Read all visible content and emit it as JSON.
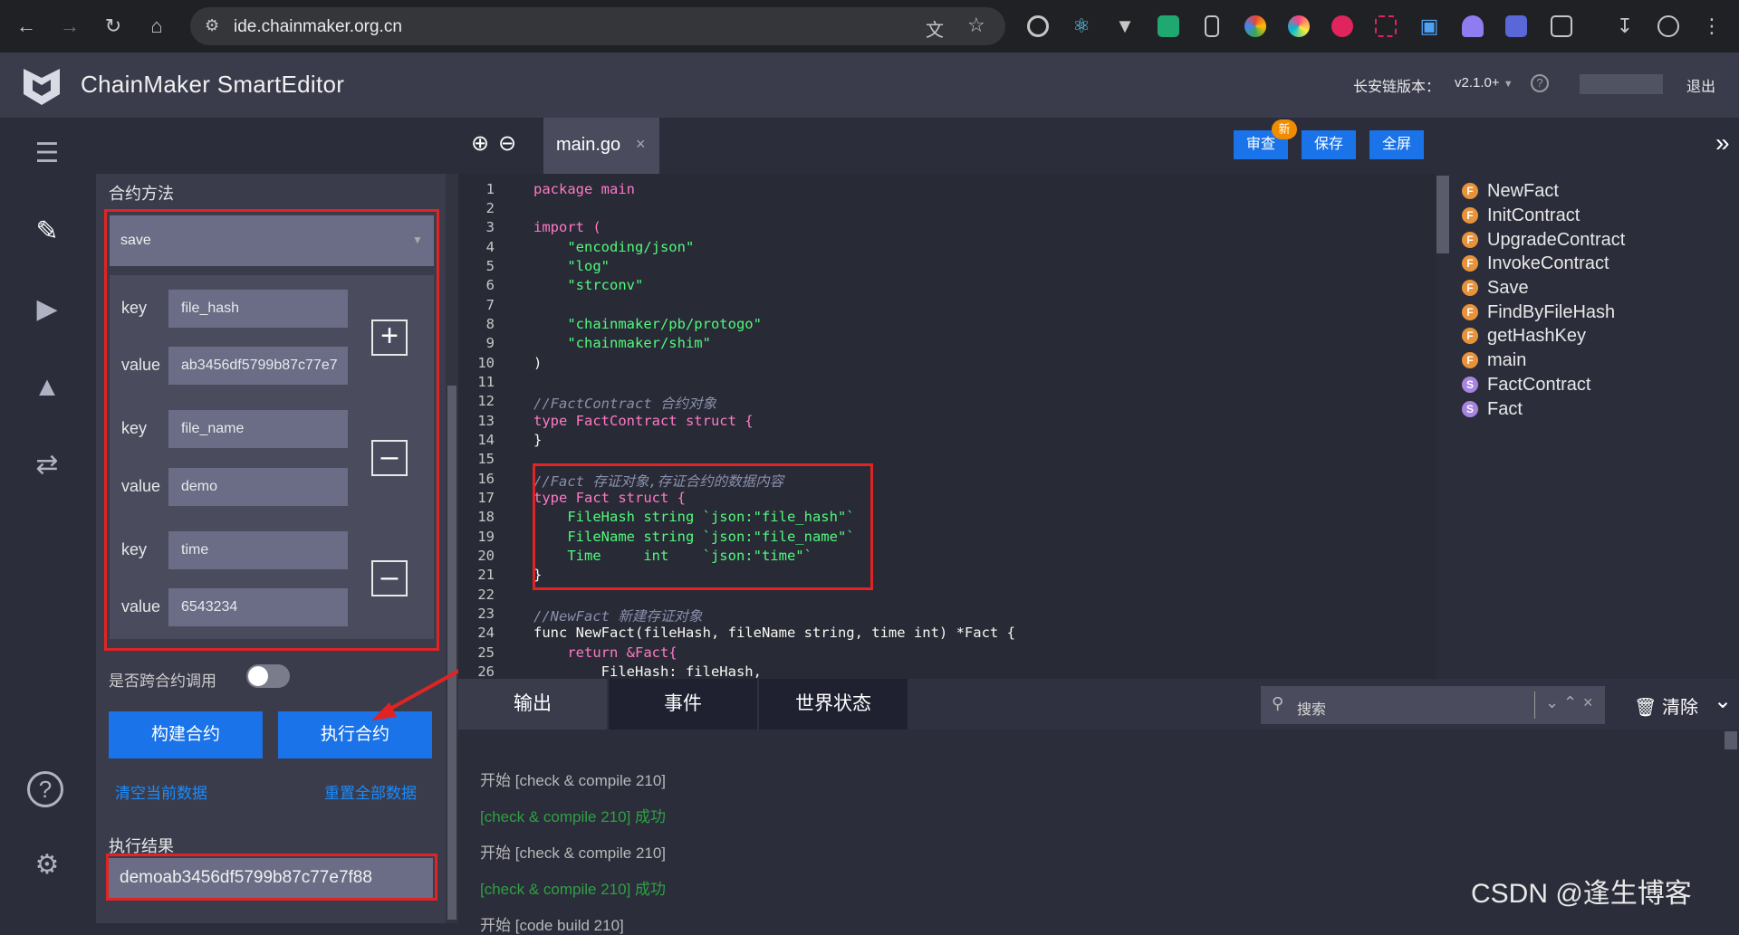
{
  "browser": {
    "url": "ide.chainmaker.org.cn"
  },
  "app": {
    "title": "ChainMaker SmartEditor",
    "version_label": "长安链版本：",
    "version_value": "v2.1.0+",
    "logout": "退出"
  },
  "panel": {
    "section_title": "合约方法",
    "method_selected": "save",
    "params": [
      {
        "key_label": "key",
        "key": "file_hash",
        "value_label": "value",
        "value": "ab3456df5799b87c77e7"
      },
      {
        "key_label": "key",
        "key": "file_name",
        "value_label": "value",
        "value": "demo"
      },
      {
        "key_label": "key",
        "key": "time",
        "value_label": "value",
        "value": "6543234"
      }
    ],
    "cross_contract_label": "是否跨合约调用",
    "build_button": "构建合约",
    "execute_button": "执行合约",
    "clear_current": "清空当前数据",
    "reset_all": "重置全部数据",
    "result_label": "执行结果",
    "result_value": "demoab3456df5799b87c77e7f88"
  },
  "editor": {
    "tab_name": "main.go",
    "review_button": "审查",
    "new_badge": "新",
    "save_button": "保存",
    "fullscreen_button": "全屏",
    "code_lines": [
      "package main",
      "",
      "import (",
      "    \"encoding/json\"",
      "    \"log\"",
      "    \"strconv\"",
      "",
      "    \"chainmaker/pb/protogo\"",
      "    \"chainmaker/shim\"",
      ")",
      "",
      "//FactContract 合约对象",
      "type FactContract struct {",
      "}",
      "",
      "//Fact 存证对象,存证合约的数据内容",
      "type Fact struct {",
      "    FileHash string `json:\"file_hash\"`",
      "    FileName string `json:\"file_name\"`",
      "    Time     int    `json:\"time\"`",
      "}",
      "",
      "//NewFact 新建存证对象",
      "func NewFact(fileHash, fileName string, time int) *Fact {",
      "    return &Fact{",
      "        FileHash: fileHash,"
    ],
    "line_numbers": [
      "1",
      "2",
      "3",
      "4",
      "5",
      "6",
      "7",
      "8",
      "9",
      "10",
      "11",
      "12",
      "13",
      "14",
      "15",
      "16",
      "17",
      "18",
      "19",
      "20",
      "21",
      "22",
      "23",
      "24",
      "25",
      "26"
    ]
  },
  "outline": [
    {
      "badge": "F",
      "name": "NewFact"
    },
    {
      "badge": "F",
      "name": "InitContract"
    },
    {
      "badge": "F",
      "name": "UpgradeContract"
    },
    {
      "badge": "F",
      "name": "InvokeContract"
    },
    {
      "badge": "F",
      "name": "Save"
    },
    {
      "badge": "F",
      "name": "FindByFileHash"
    },
    {
      "badge": "F",
      "name": "getHashKey"
    },
    {
      "badge": "F",
      "name": "main"
    },
    {
      "badge": "S",
      "name": "FactContract"
    },
    {
      "badge": "S",
      "name": "Fact"
    }
  ],
  "bottom": {
    "tabs": [
      "输出",
      "事件",
      "世界状态"
    ],
    "search_placeholder": "搜索",
    "clear_button": "清除",
    "output_lines": [
      {
        "text": "开始 [check & compile 210]",
        "color": "#b8b8b8"
      },
      {
        "text": "[check & compile 210] 成功",
        "color": "#2ea043"
      },
      {
        "text": "开始 [check & compile 210]",
        "color": "#b8b8b8"
      },
      {
        "text": "[check & compile 210] 成功",
        "color": "#2ea043"
      },
      {
        "text": "开始 [code build 210]",
        "color": "#b8b8b8"
      }
    ]
  },
  "watermark": "CSDN @逢生博客"
}
